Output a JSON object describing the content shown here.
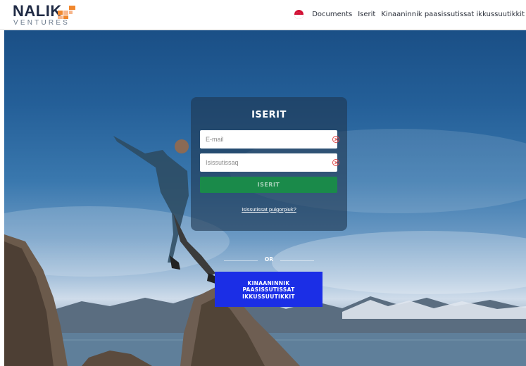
{
  "header": {
    "logo": {
      "name": "NALIK",
      "subtitle": "VENTURES"
    },
    "language_flag": "greenland-flag-icon",
    "nav": {
      "documents": "Documents",
      "login": "Iserit",
      "register": "Kinaaninnik paasissutissat ikkussuutikkit"
    }
  },
  "login_card": {
    "title": "ISERIT",
    "email_placeholder": "E-mail",
    "password_placeholder": "Isissutissaq",
    "submit_label": "ISERIT",
    "forgot_link": "Isissutissat puigorpiuk?"
  },
  "divider": {
    "label": "OR"
  },
  "register_button": {
    "label": "KINAANINNIK\nPAASISSUTISSAT\nIKKUSSUUTIKKIT"
  },
  "colors": {
    "brand_dark": "#1f2a44",
    "logo_orange": "#f0872d",
    "login_green": "#1a8a4a",
    "register_blue": "#1b2ee6",
    "error_red": "#e04848"
  }
}
